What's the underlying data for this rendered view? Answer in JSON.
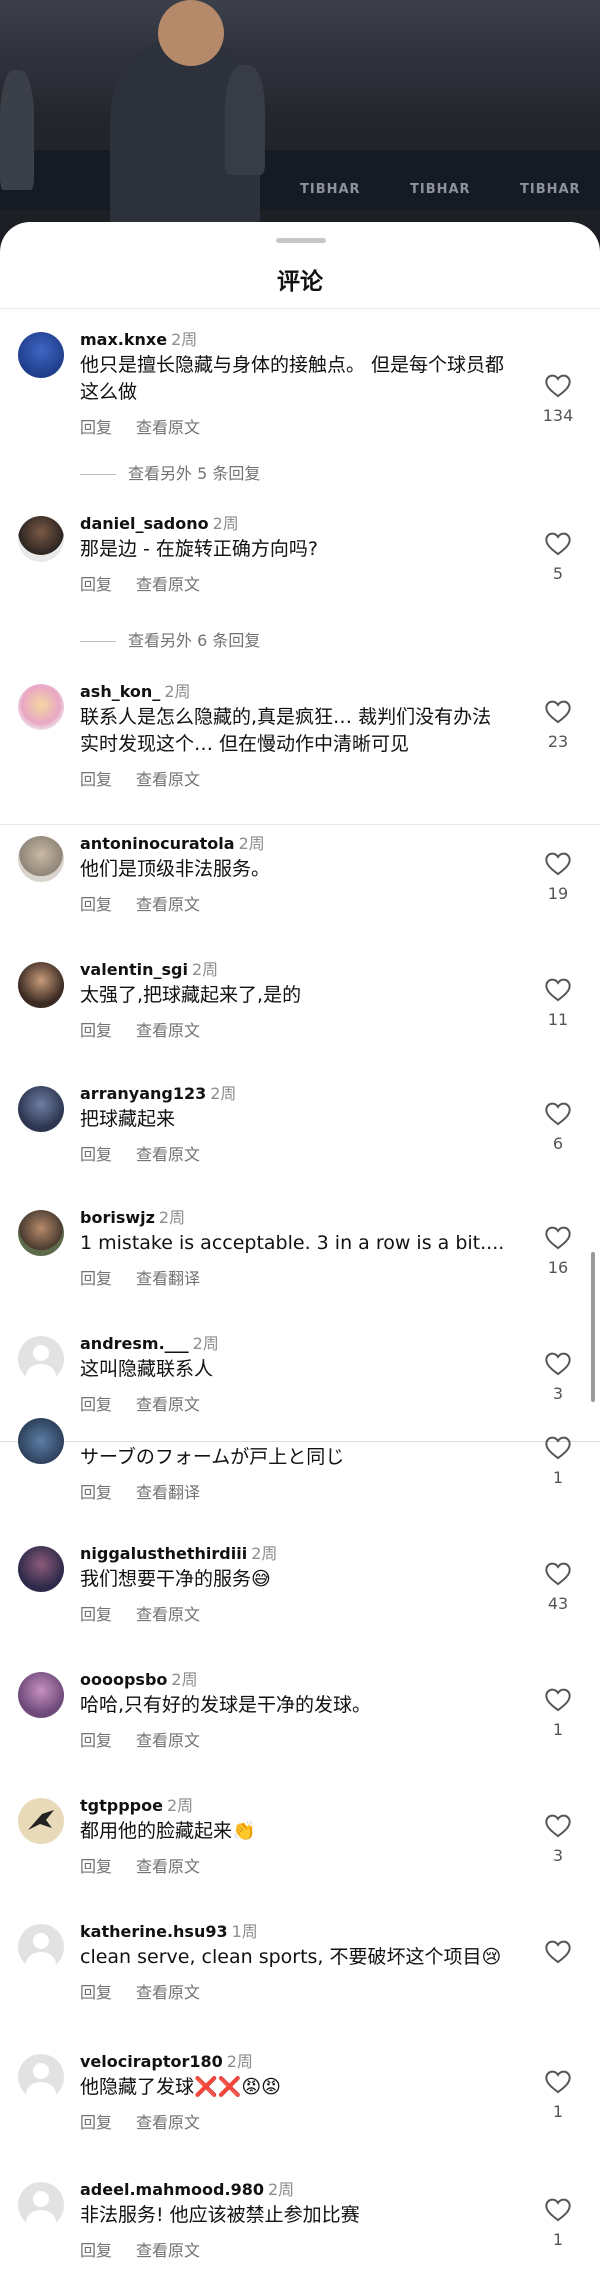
{
  "header": {
    "title": "评论"
  },
  "actions": {
    "reply": "回复",
    "view_original": "查看原文",
    "view_translation": "查看翻译"
  },
  "video": {
    "board_labels": [
      "TIBHAR",
      "TIBHAR",
      "TIBHAR"
    ]
  },
  "comments": [
    {
      "username": "max.knxe",
      "time": "2周",
      "text": "他只是擅长隐藏与身体的接触点。 但是每个球员都这么做",
      "likes": "134",
      "action2": "查看原文",
      "more_replies": "查看另外 5 条回复"
    },
    {
      "username": "daniel_sadono",
      "time": "2周",
      "text": "那是边 - 在旋转正确方向吗?",
      "likes": "5",
      "action2": "查看原文",
      "more_replies": "查看另外 6 条回复"
    },
    {
      "username": "ash_kon_",
      "time": "2周",
      "text": "联系人是怎么隐藏的,真是疯狂… 裁判们没有办法实时发现这个… 但在慢动作中清晰可见",
      "likes": "23",
      "action2": "查看原文"
    },
    {
      "username": "antoninocuratola",
      "time": "2周",
      "text": "他们是顶级非法服务。",
      "likes": "19",
      "action2": "查看原文"
    },
    {
      "username": "valentin_sgi",
      "time": "2周",
      "text": "太强了,把球藏起来了,是的",
      "likes": "11",
      "action2": "查看原文"
    },
    {
      "username": "arranyang123",
      "time": "2周",
      "text": "把球藏起来",
      "likes": "6",
      "action2": "查看原文"
    },
    {
      "username": "boriswjz",
      "time": "2周",
      "text": "1 mistake is acceptable. 3 in a row is a bit....",
      "likes": "16",
      "action2": "查看翻译"
    },
    {
      "username": "andresm.___",
      "time": "2周",
      "text": "这叫隐藏联系人",
      "likes": "3",
      "action2": "查看原文"
    },
    {
      "username": "",
      "time": "",
      "text": "サーブのフォームが戸上と同じ",
      "likes": "1",
      "action2": "查看翻译"
    },
    {
      "username": "niggalusthethirdiii",
      "time": "2周",
      "text": "我们想要干净的服务😅",
      "likes": "43",
      "action2": "查看原文"
    },
    {
      "username": "oooopsbo",
      "time": "2周",
      "text": "哈哈,只有好的发球是干净的发球。",
      "likes": "1",
      "action2": "查看原文"
    },
    {
      "username": "tgtpppoe",
      "time": "2周",
      "text": "都用他的脸藏起来👏",
      "likes": "3",
      "action2": "查看原文"
    },
    {
      "username": "katherine.hsu93",
      "time": "1周",
      "text": "clean serve, clean sports, 不要破坏这个项目😢",
      "likes": "",
      "action2": "查看原文"
    },
    {
      "username": "velociraptor180",
      "time": "2周",
      "text": "他隐藏了发球❌❌😡😡",
      "likes": "1",
      "action2": "查看原文"
    },
    {
      "username": "adeel.mahmood.980",
      "time": "2周",
      "text": "非法服务! 他应该被禁止参加比赛",
      "likes": "1",
      "action2": "查看原文"
    }
  ],
  "colors": {
    "sheet_bg": "#ffffff",
    "secondary_text": "#737373",
    "divider": "#e9e9e9"
  }
}
